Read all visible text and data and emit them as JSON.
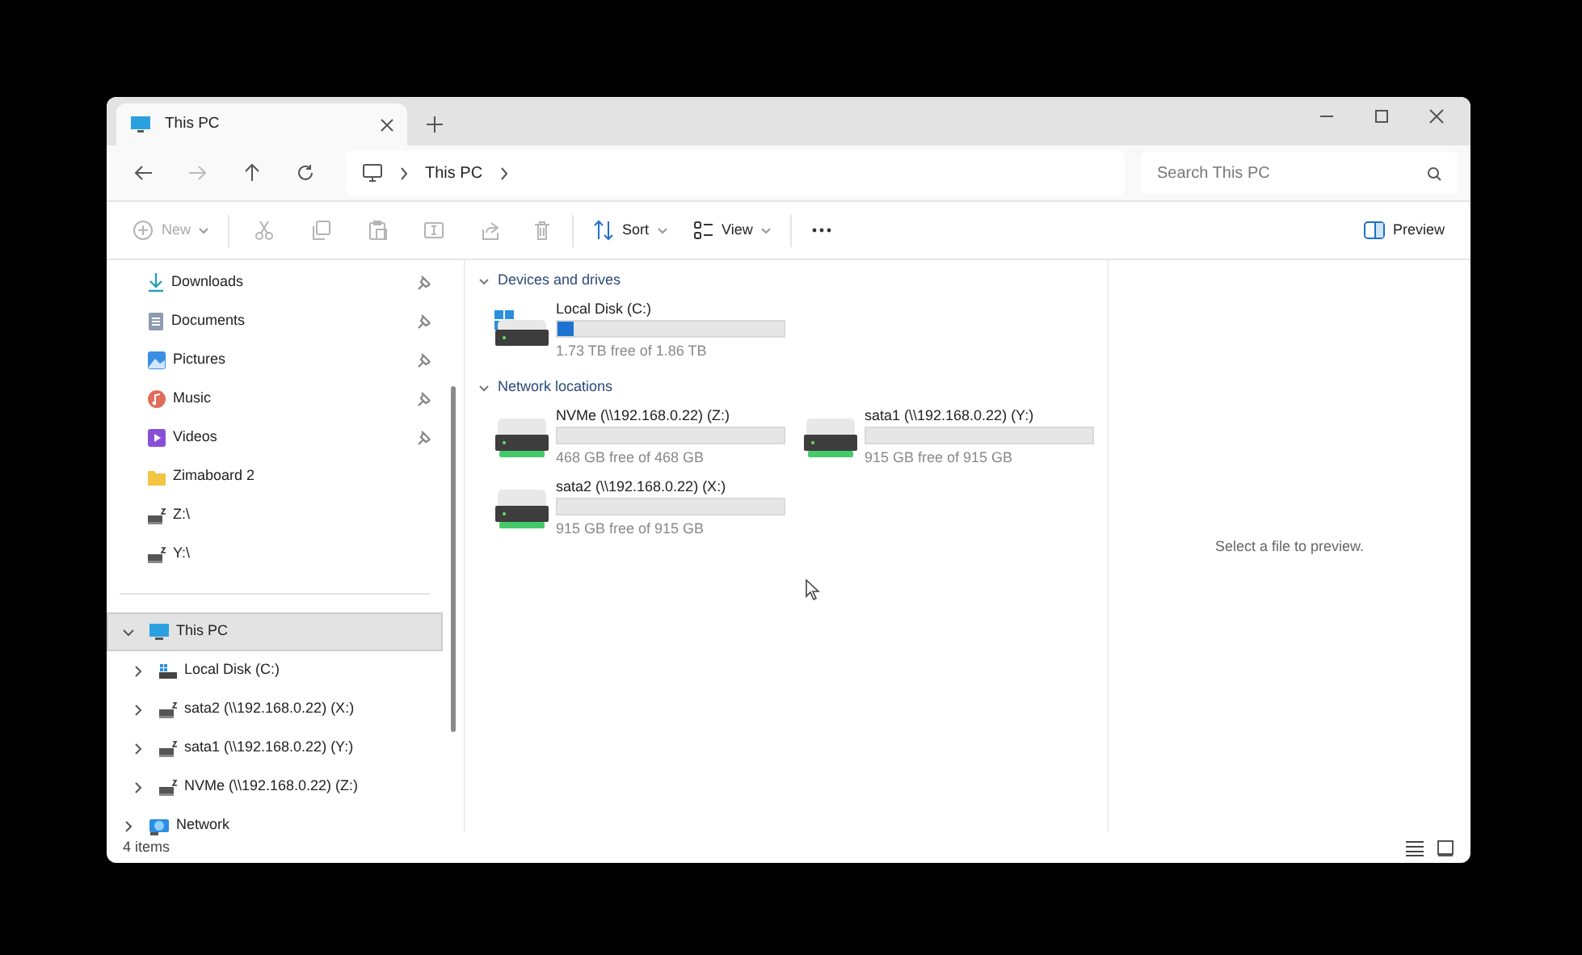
{
  "window": {
    "tabs": [
      {
        "title": "This PC",
        "selected": true
      }
    ]
  },
  "address": {
    "breadcrumb": [
      "This PC"
    ],
    "search": {
      "placeholder": "Search This PC"
    }
  },
  "toolbar": [
    {
      "kind": "new",
      "label": "New",
      "disabled": true
    },
    {
      "kind": "cut",
      "disabled": true
    },
    {
      "kind": "copy",
      "disabled": true
    },
    {
      "kind": "paste",
      "disabled": true
    },
    {
      "kind": "rename",
      "disabled": true
    },
    {
      "kind": "share",
      "disabled": true
    },
    {
      "kind": "delete",
      "disabled": true
    },
    {
      "kind": "sort",
      "label": "Sort",
      "disabled": false
    },
    {
      "kind": "view",
      "label": "View",
      "disabled": false
    },
    {
      "kind": "more",
      "disabled": false
    }
  ],
  "preview_button": {
    "label": "Preview",
    "selected": true
  },
  "sidebar": {
    "quick_access": [
      {
        "kind": "downloads",
        "label": "Downloads",
        "pinned": true
      },
      {
        "kind": "documents",
        "label": "Documents",
        "pinned": true
      },
      {
        "kind": "pictures",
        "label": "Pictures",
        "pinned": true
      },
      {
        "kind": "music",
        "label": "Music",
        "pinned": true
      },
      {
        "kind": "videos",
        "label": "Videos",
        "pinned": true
      },
      {
        "kind": "folder",
        "label": "Zimaboard 2",
        "pinned": false
      },
      {
        "kind": "netdrive",
        "label": "Z:\\",
        "pinned": false
      },
      {
        "kind": "netdrive",
        "label": "Y:\\",
        "pinned": false
      }
    ],
    "tree": [
      {
        "kind": "pc",
        "label": "This PC",
        "expanded": true,
        "selected": true,
        "children": [
          {
            "kind": "disk",
            "label": "Local Disk (C:)",
            "expanded": false,
            "selected": false
          },
          {
            "kind": "netdrive",
            "label": "sata2 (\\\\192.168.0.22) (X:)",
            "expanded": false,
            "selected": false
          },
          {
            "kind": "netdrive",
            "label": "sata1 (\\\\192.168.0.22) (Y:)",
            "expanded": false,
            "selected": false
          },
          {
            "kind": "netdrive",
            "label": "NVMe (\\\\192.168.0.22) (Z:)",
            "expanded": false,
            "selected": false
          }
        ]
      },
      {
        "kind": "network",
        "label": "Network",
        "expanded": false,
        "selected": false
      }
    ]
  },
  "sections": [
    {
      "title": "Devices and drives",
      "expanded": true,
      "drives": [
        {
          "kind": "local",
          "name": "Local Disk (C:)",
          "level": 0.07,
          "free": "1.73 TB free of 1.86 TB"
        }
      ]
    },
    {
      "title": "Network locations",
      "expanded": true,
      "drives": [
        {
          "kind": "network",
          "name": "NVMe (\\\\192.168.0.22) (Z:)",
          "level": 0,
          "free": "468 GB free of 468 GB"
        },
        {
          "kind": "network",
          "name": "sata1 (\\\\192.168.0.22) (Y:)",
          "level": 0,
          "free": "915 GB free of 915 GB"
        },
        {
          "kind": "network",
          "name": "sata2 (\\\\192.168.0.22) (X:)",
          "level": 0,
          "free": "915 GB free of 915 GB"
        }
      ]
    }
  ],
  "preview": {
    "message": "Select a file to preview."
  },
  "status_bar": {
    "count": "4 items"
  }
}
